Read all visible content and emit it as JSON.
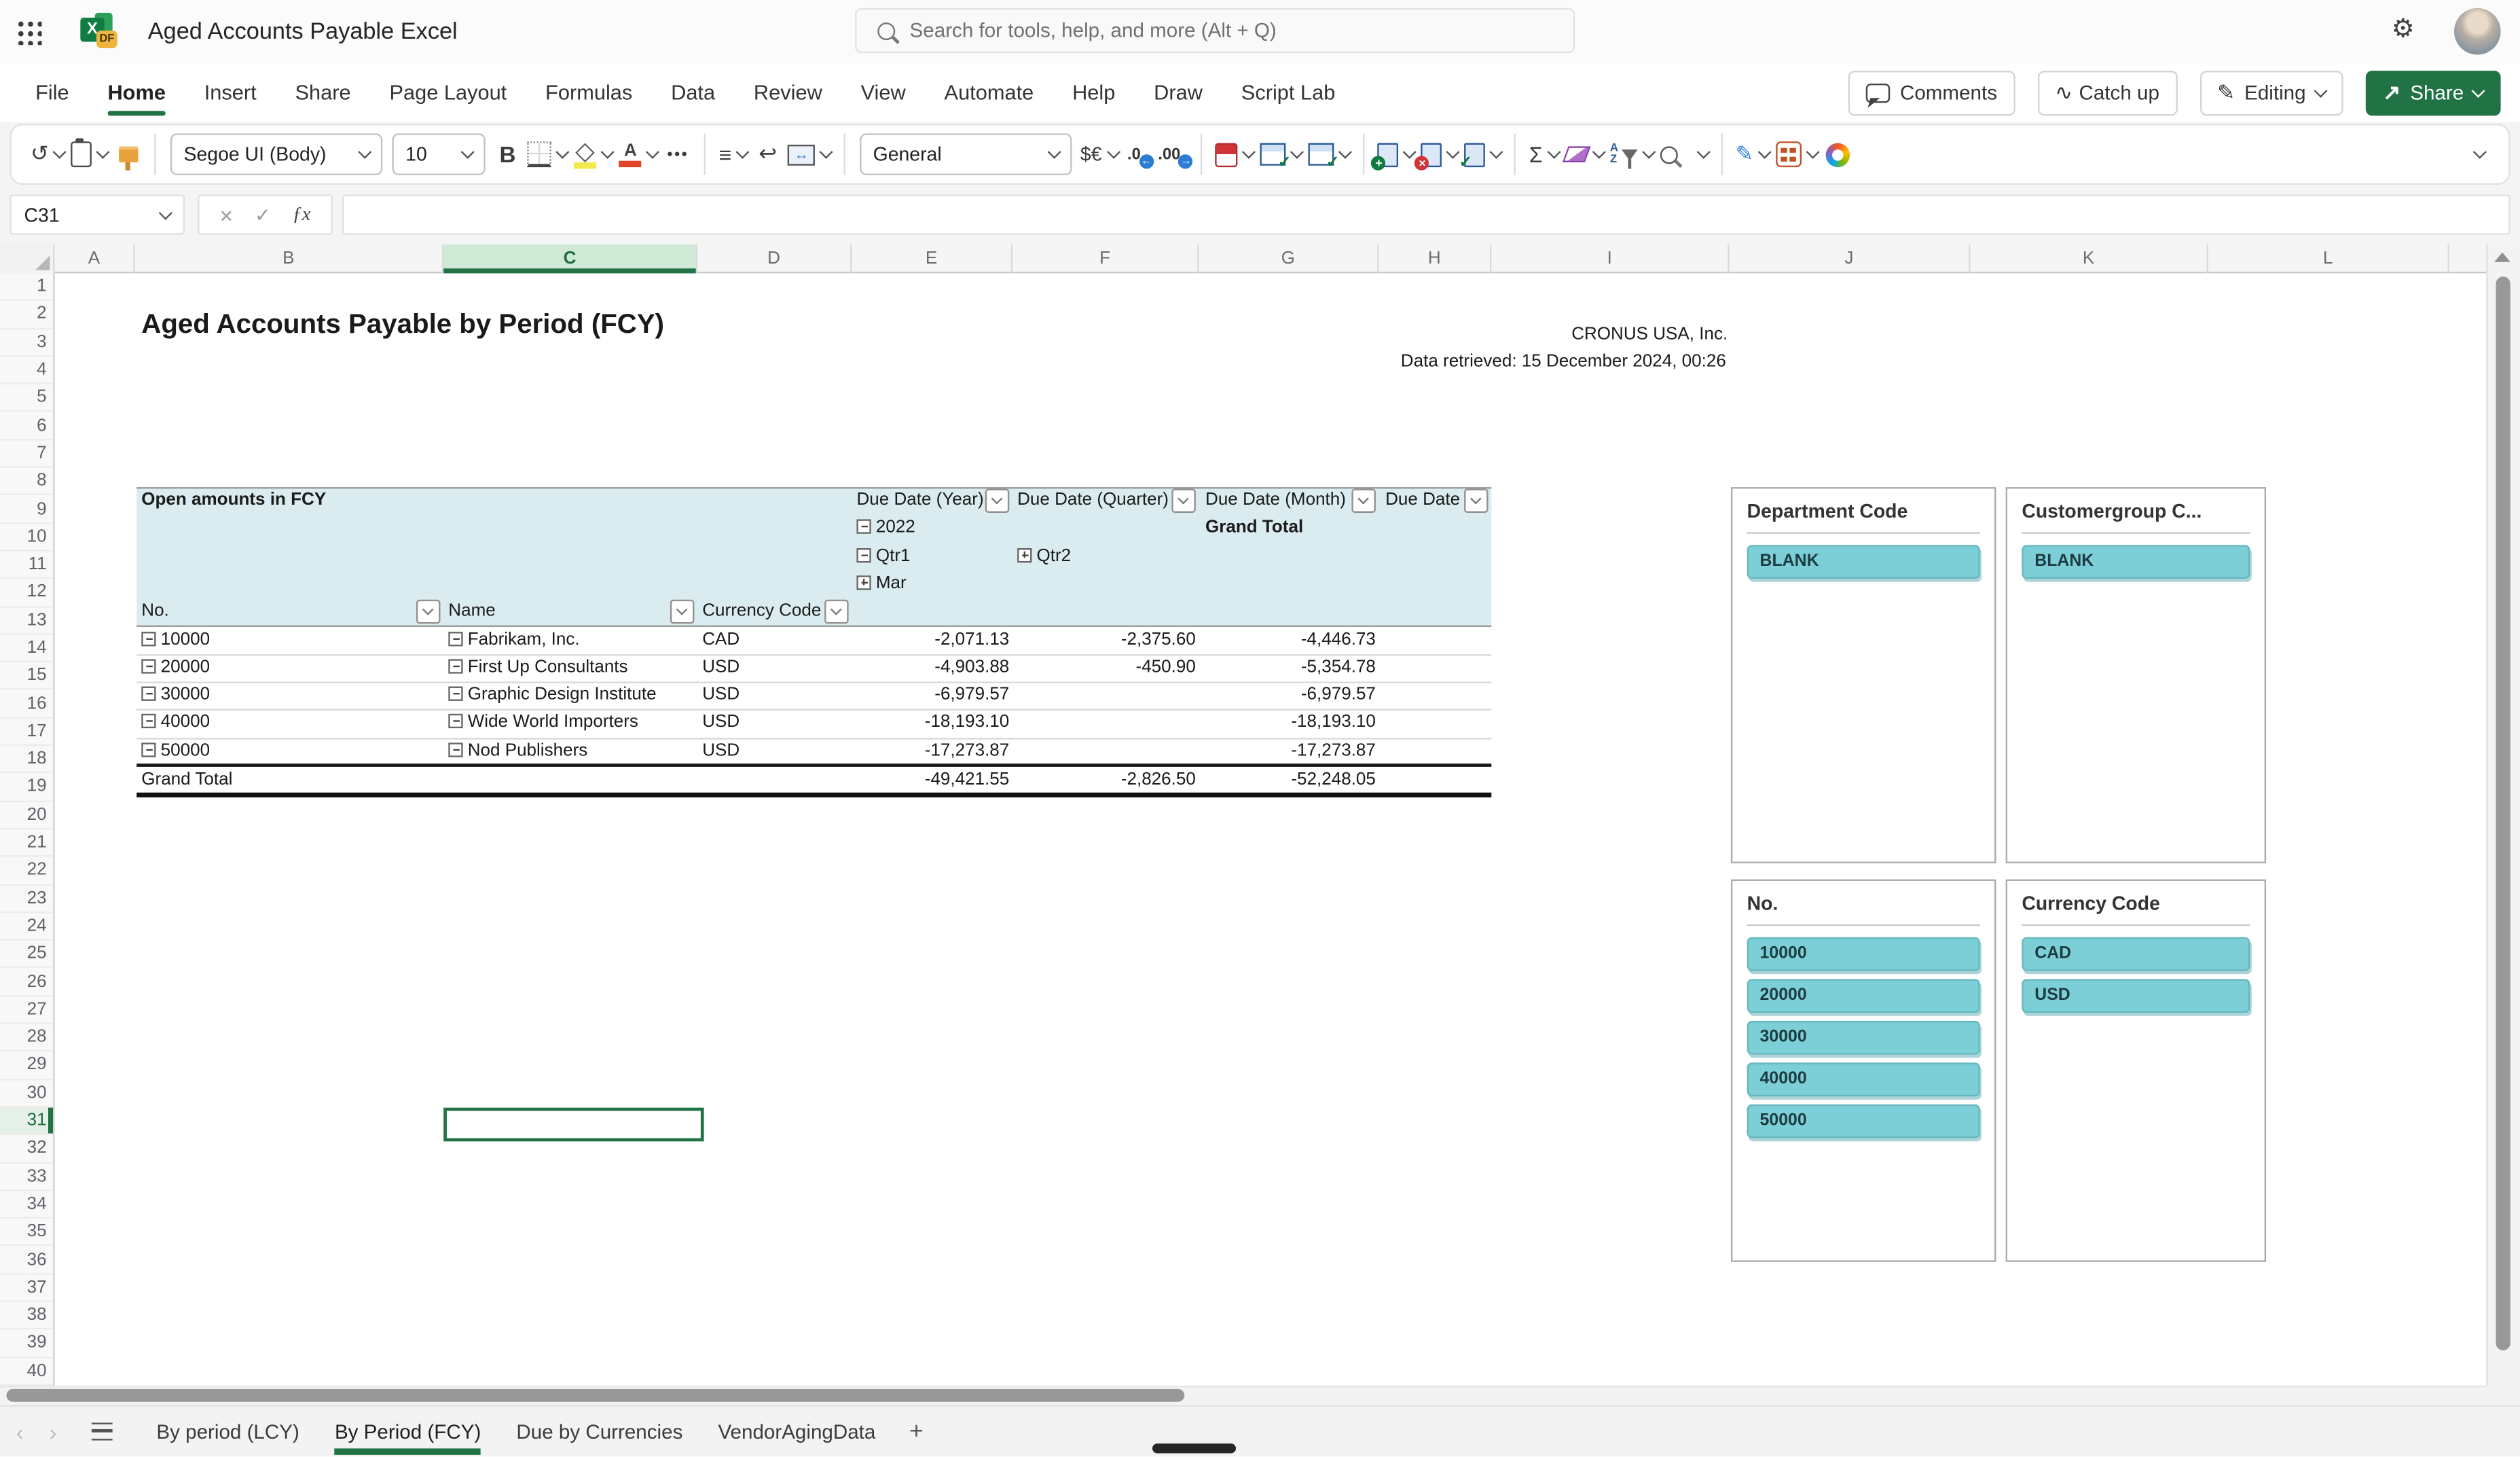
{
  "colors": {
    "excel_green": "#217346",
    "slicer_teal": "#7CCFD6",
    "pivot_header_blue": "#DAECEF"
  },
  "topbar": {
    "title": "Aged Accounts Payable Excel",
    "search_placeholder": "Search for tools, help, and more (Alt + Q)"
  },
  "menu": {
    "tabs": [
      "File",
      "Home",
      "Insert",
      "Share",
      "Page Layout",
      "Formulas",
      "Data",
      "Review",
      "View",
      "Automate",
      "Help",
      "Draw",
      "Script Lab"
    ],
    "active_tab": "Home",
    "comments_label": "Comments",
    "catchup_label": "Catch up",
    "editing_label": "Editing",
    "share_label": "Share"
  },
  "toolbar": {
    "font_name": "Segoe UI (Body)",
    "font_size": "10",
    "number_format": "General"
  },
  "formula_bar": {
    "name_box": "C31",
    "formula": ""
  },
  "grid": {
    "columns": [
      "A",
      "B",
      "C",
      "D",
      "E",
      "F",
      "G",
      "H",
      "I",
      "J",
      "K",
      "L"
    ],
    "row_count": 40,
    "selected_column": "C",
    "selected_row": 31,
    "selected_cell": "C31"
  },
  "sheet": {
    "title": "Aged Accounts Payable by Period (FCY)",
    "company": "CRONUS USA, Inc.",
    "retrieved": "Data retrieved: 15 December 2024, 00:26",
    "pivot": {
      "caption": "Open amounts in FCY",
      "col_fields": [
        "Due Date (Year)",
        "Due Date (Quarter)",
        "Due Date (Month)",
        "Due Date"
      ],
      "year": "2022",
      "grand_total_label": "Grand Total",
      "quarter_expanded": "Qtr1",
      "quarter_collapsed": "Qtr2",
      "month": "Mar",
      "row_fields": [
        "No.",
        "Name",
        "Currency Code"
      ],
      "rows": [
        {
          "no": "10000",
          "name": "Fabrikam, Inc.",
          "currency": "CAD",
          "qtr1": "-2,071.13",
          "qtr2": "-2,375.60",
          "total": "-4,446.73"
        },
        {
          "no": "20000",
          "name": "First Up Consultants",
          "currency": "USD",
          "qtr1": "-4,903.88",
          "qtr2": "-450.90",
          "total": "-5,354.78"
        },
        {
          "no": "30000",
          "name": "Graphic Design Institute",
          "currency": "USD",
          "qtr1": "-6,979.57",
          "qtr2": "",
          "total": "-6,979.57"
        },
        {
          "no": "40000",
          "name": "Wide World Importers",
          "currency": "USD",
          "qtr1": "-18,193.10",
          "qtr2": "",
          "total": "-18,193.10"
        },
        {
          "no": "50000",
          "name": "Nod Publishers",
          "currency": "USD",
          "qtr1": "-17,273.87",
          "qtr2": "",
          "total": "-17,273.87"
        }
      ],
      "grand_total": {
        "label": "Grand Total",
        "qtr1": "-49,421.55",
        "qtr2": "-2,826.50",
        "total": "-52,248.05"
      }
    },
    "slicers": [
      {
        "title": "Department Code",
        "items": [
          "BLANK"
        ]
      },
      {
        "title": "Customergroup C...",
        "items": [
          "BLANK"
        ]
      },
      {
        "title": "No.",
        "items": [
          "10000",
          "20000",
          "30000",
          "40000",
          "50000"
        ]
      },
      {
        "title": "Currency Code",
        "items": [
          "CAD",
          "USD"
        ]
      }
    ]
  },
  "tabbar": {
    "tabs": [
      "By period (LCY)",
      "By Period (FCY)",
      "Due by Currencies",
      "VendorAgingData"
    ],
    "active_tab": "By Period (FCY)"
  },
  "icons": {
    "undo": "↺",
    "more": "•••",
    "bold": "B",
    "align": "≡",
    "wrap": "↩",
    "merge": "↔",
    "currency": "$€",
    "decrease_decimal": ".0",
    "increase_decimal": ".00",
    "arrow_left": "←",
    "arrow_right": "→",
    "autosum": "Σ",
    "settings": "⚙",
    "editing_pencil": "✎",
    "share_arrow": "↗",
    "cancel": "×",
    "enter": "✓",
    "function": "ƒx",
    "catch_up": "∿",
    "ink": "✎",
    "new_sheet": "+",
    "nav_prev": "‹",
    "nav_next": "›"
  }
}
